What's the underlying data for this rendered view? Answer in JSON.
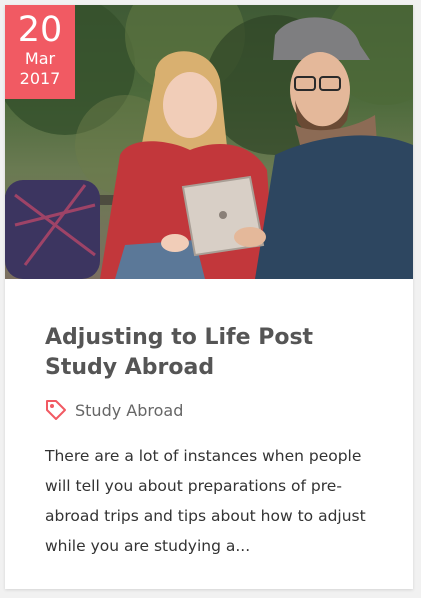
{
  "post": {
    "date": {
      "day": "20",
      "month": "Mar",
      "year": "2017"
    },
    "title": "Adjusting to Life Post Study Abroad",
    "category": {
      "icon": "tag-icon",
      "label": "Study Abroad"
    },
    "excerpt": "There are a lot of instances when people will tell you about preparations of pre-abroad trips and tips about how to adjust while you are studying a...",
    "image": {
      "icon": "photo-couple-with-tablet"
    }
  },
  "colors": {
    "accent": "#f15a63",
    "title": "#555555",
    "text": "#333333",
    "card": "#ffffff",
    "background": "#f1f1f1"
  }
}
